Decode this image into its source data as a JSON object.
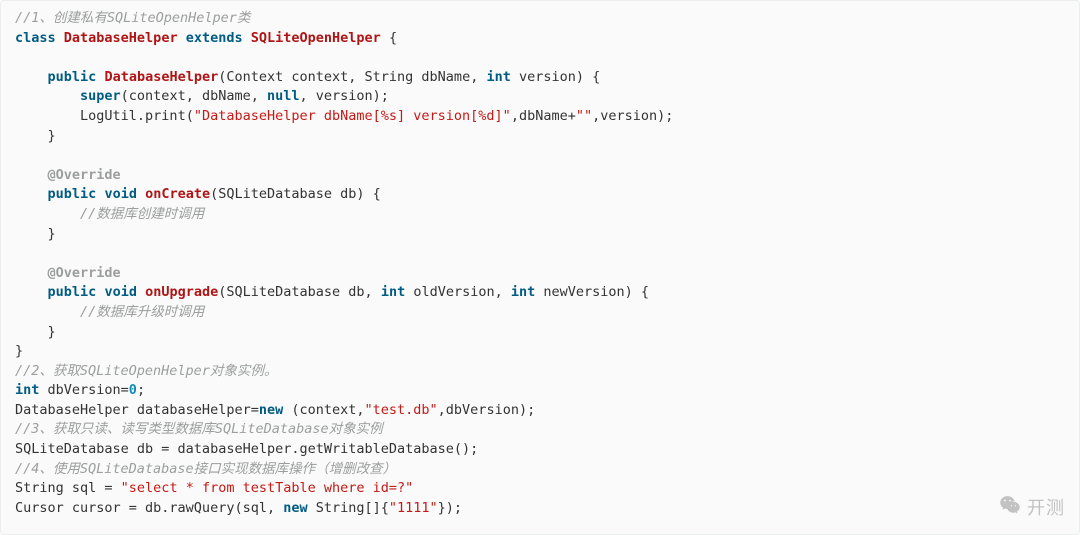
{
  "code": {
    "c1": "//1、创建私有SQLiteOpenHelper类",
    "kw_class": "class",
    "cls_DatabaseHelper": "DatabaseHelper",
    "kw_extends": "extends",
    "cls_SQLiteOpenHelper": "SQLiteOpenHelper",
    "brace_open": "{",
    "brace_close": "}",
    "kw_public": "public",
    "ctor_name": "DatabaseHelper",
    "ctor_params_a": "(Context context, String dbName, ",
    "kw_int": "int",
    "ctor_params_b": " version) {",
    "kw_super": "super",
    "super_args_a": "(context, dbName, ",
    "kw_null": "null",
    "super_args_b": ", version);",
    "log_call_a": "LogUtil.print(",
    "log_str": "\"DatabaseHelper dbName[%s] version[%d]\"",
    "log_call_b": ",dbName+",
    "log_empty": "\"\"",
    "log_call_c": ",version);",
    "ann_override": "@Override",
    "kw_void": "void",
    "fn_onCreate": "onCreate",
    "onCreate_params": "(SQLiteDatabase db) {",
    "c_onCreate": "//数据库创建时调用",
    "fn_onUpgrade": "onUpgrade",
    "onUpgrade_params_a": "(SQLiteDatabase db, ",
    "onUpgrade_params_b": " oldVersion, ",
    "onUpgrade_params_c": " newVersion) {",
    "c_onUpgrade": "//数据库升级时调用",
    "c2": "//2、获取SQLiteOpenHelper对象实例。",
    "dbVersion_decl": " dbVersion=",
    "zero": "0",
    "semi": ";",
    "dbHelper_decl_a": "DatabaseHelper databaseHelper=",
    "kw_new": "new",
    "dbHelper_decl_b": " (context,",
    "str_testdb": "\"test.db\"",
    "dbHelper_decl_c": ",dbVersion);",
    "c3": "//3、获取只读、读写类型数据库SQLiteDatabase对象实例",
    "getdb": "SQLiteDatabase db = databaseHelper.getWritableDatabase();",
    "c4": "//4、使用SQLiteDatabase接口实现数据库操作（增删改查）",
    "sql_decl_a": "String sql = ",
    "str_sql": "\"select * from testTable where id=?\"",
    "cursor_a": "Cursor cursor = db.rawQuery(sql, ",
    "cursor_b": " String[]{",
    "str_1111": "\"1111\"",
    "cursor_c": "});"
  },
  "watermark": {
    "text": "开测"
  }
}
